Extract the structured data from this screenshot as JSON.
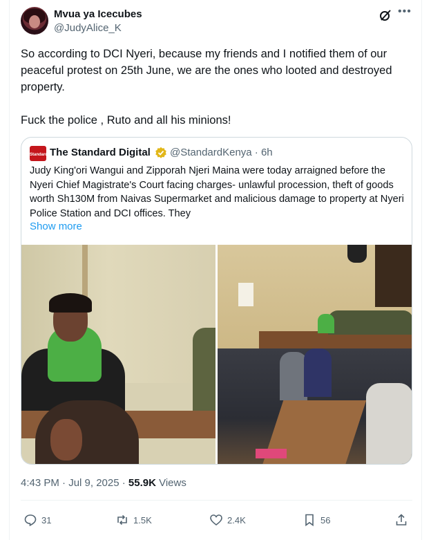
{
  "author": {
    "display_name": "Mvua ya Icecubes",
    "handle": "@JudyAlice_K",
    "avatar_icon": "profile-photo"
  },
  "tweet": {
    "text": "So according to DCI Nyeri, because my friends and I notified them of our peaceful protest on 25th June, we are the ones who looted and destroyed property.\n\nFuck the police , Ruto and all his minions!"
  },
  "quote": {
    "display_name": "The Standard Digital",
    "handle_time": "@StandardKenya · 6h",
    "text": "Judy King'ori Wangui and Zipporah Njeri Maina were today arraigned before the Nyeri Chief Magistrate's Court facing charges- unlawful procession, theft of goods worth Sh130M from Naivas Supermarket and malicious damage to property at Nyeri Police Station and DCI offices. They",
    "show_more": "Show more",
    "logo_text": "Standard"
  },
  "meta": {
    "time_date": "4:43 PM · Jul 9, 2025 · ",
    "views_count": "55.9K",
    "views_label": " Views"
  },
  "actions": {
    "replies": "31",
    "reposts": "1.5K",
    "likes": "2.4K",
    "bookmarks": "56"
  },
  "colors": {
    "accent": "#1d9bf0",
    "text_primary": "#0f1419",
    "text_secondary": "#536471",
    "border": "#cfd9de",
    "verified_gold": "#e2b719",
    "standard_red": "#c4161c"
  }
}
